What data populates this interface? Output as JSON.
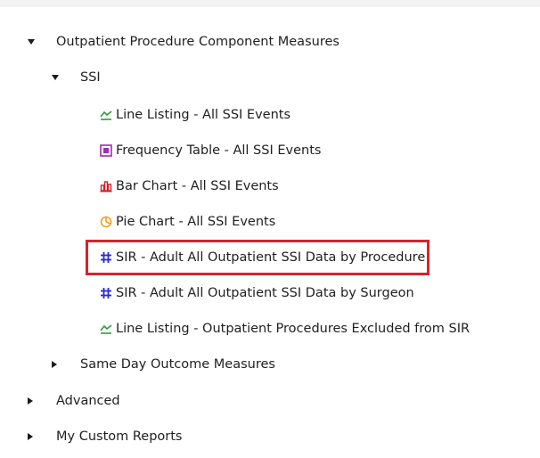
{
  "tree": {
    "outpatient": {
      "label": "Outpatient Procedure Component Measures"
    },
    "ssi": {
      "label": "SSI"
    },
    "reports": [
      {
        "label": "Line Listing - All SSI Events",
        "icon": "line-listing-icon",
        "color": "#2e9e3a"
      },
      {
        "label": "Frequency Table - All SSI Events",
        "icon": "frequency-table-icon",
        "color": "#9b2fae"
      },
      {
        "label": "Bar Chart - All SSI Events",
        "icon": "bar-chart-icon",
        "color": "#d0202a"
      },
      {
        "label": "Pie Chart - All SSI Events",
        "icon": "pie-chart-icon",
        "color": "#f0a020"
      },
      {
        "label": "SIR - Adult All Outpatient SSI Data by Procedure",
        "icon": "sir-grid-icon",
        "color": "#2a2ad0"
      },
      {
        "label": "SIR - Adult All Outpatient SSI Data by Surgeon",
        "icon": "sir-grid-icon",
        "color": "#2a2ad0"
      },
      {
        "label": "Line Listing - Outpatient Procedures Excluded from SIR",
        "icon": "line-listing-icon",
        "color": "#2e9e3a"
      }
    ],
    "same_day": {
      "label": "Same Day Outcome Measures"
    },
    "advanced": {
      "label": "Advanced"
    },
    "custom": {
      "label": "My Custom Reports"
    }
  },
  "highlight_color": "#d9232a"
}
